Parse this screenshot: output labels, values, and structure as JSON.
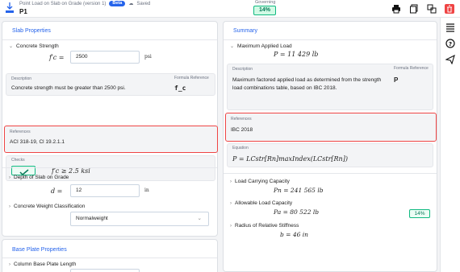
{
  "header": {
    "breadcrumb": "Point Load on Slab on Grade (version 1)",
    "beta": "Beta",
    "saved": "Saved",
    "project_name": "P1",
    "governing_label": "Governing",
    "governing_value": "14%"
  },
  "slab": {
    "title": "Slab Properties",
    "concrete_strength": {
      "label": "Concrete Strength",
      "symbol": "f′c =",
      "value": "2500",
      "unit": "psi",
      "description_label": "Description",
      "description": "Concrete strength must be greater than 2500 psi.",
      "formula_ref_label": "Formula Reference",
      "formula_ref": "f_c",
      "references_label": "References",
      "references": "ACI 318-19, Cl 19.2.1.1",
      "checks_label": "Checks",
      "check_expr": "f′c ≥ 2.5 ksi"
    },
    "depth": {
      "label": "Depth of Slab on Grade",
      "symbol": "d =",
      "value": "12",
      "unit": "in"
    },
    "weight": {
      "label": "Concrete Weight Classification",
      "value": "Normalweight"
    }
  },
  "base_plate": {
    "title": "Base Plate Properties",
    "length_label": "Column Base Plate Length"
  },
  "summary": {
    "title": "Summary",
    "max_load_label": "Maximum Applied Load",
    "max_load_expr": "P =  11 429 lb",
    "description_label": "Description",
    "description": "Maximum factored applied load as determined from the strength load combinations table, based on IBC 2018.",
    "formula_ref_label": "Formula Reference",
    "formula_ref": "P",
    "references_label": "References",
    "references": "IBC 2018",
    "equation_label": "Equation",
    "equation": "P = LCstr[Rn]maxIndex(LCstr[Rn])",
    "results": [
      {
        "label": "Load Carrying Capacity",
        "expr": "Pn =  241 565 lb"
      },
      {
        "label": "Allowable Load Capacity",
        "expr": "Pa =  80 522 lb",
        "badge": "14%"
      },
      {
        "label": "Radius of Relative Stiffness",
        "expr": "b =  46 in"
      }
    ]
  },
  "colors": {
    "accent": "#2563eb",
    "ok": "#10b981",
    "danger": "#ef4444"
  }
}
